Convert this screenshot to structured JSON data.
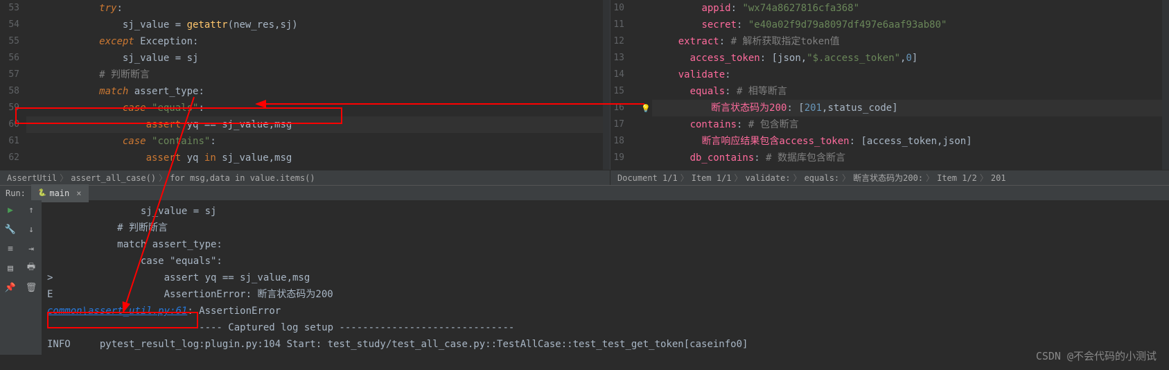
{
  "left_editor": {
    "lines": [
      {
        "n": 54,
        "indent": "                ",
        "tokens": [
          {
            "t": "sj_value ",
            "c": "var"
          },
          {
            "t": "= ",
            "c": "var"
          },
          {
            "t": "getattr",
            "c": "fn"
          },
          {
            "t": "(new_res,sj)",
            "c": "var"
          }
        ]
      },
      {
        "n": 55,
        "indent": "            ",
        "tokens": [
          {
            "t": "except ",
            "c": "kw"
          },
          {
            "t": "Exception",
            "c": "var"
          },
          {
            "t": ":",
            "c": "var"
          }
        ]
      },
      {
        "n": 56,
        "indent": "                ",
        "tokens": [
          {
            "t": "sj_value ",
            "c": "var"
          },
          {
            "t": "= ",
            "c": "var"
          },
          {
            "t": "sj",
            "c": "var"
          }
        ]
      },
      {
        "n": 57,
        "indent": "            ",
        "tokens": [
          {
            "t": "# 判断断言",
            "c": "cmt"
          }
        ]
      },
      {
        "n": 58,
        "indent": "            ",
        "tokens": [
          {
            "t": "match ",
            "c": "kw"
          },
          {
            "t": "assert_type",
            "c": "var"
          },
          {
            "t": ":",
            "c": "var"
          }
        ]
      },
      {
        "n": 59,
        "indent": "                ",
        "tokens": [
          {
            "t": "case ",
            "c": "kw"
          },
          {
            "t": "\"equals\"",
            "c": "str"
          },
          {
            "t": ":",
            "c": "var"
          }
        ]
      },
      {
        "n": 60,
        "indent": "                    ",
        "tokens": [
          {
            "t": "assert ",
            "c": "kw2"
          },
          {
            "t": "yq ",
            "c": "var"
          },
          {
            "t": "== ",
            "c": "var"
          },
          {
            "t": "sj_value,msg",
            "c": "var"
          }
        ],
        "hl": true
      },
      {
        "n": 61,
        "indent": "                ",
        "tokens": [
          {
            "t": "case ",
            "c": "kw"
          },
          {
            "t": "\"contains\"",
            "c": "str"
          },
          {
            "t": ":",
            "c": "var"
          }
        ]
      },
      {
        "n": 62,
        "indent": "                    ",
        "tokens": [
          {
            "t": "assert ",
            "c": "kw2"
          },
          {
            "t": "yq ",
            "c": "var"
          },
          {
            "t": "in ",
            "c": "kw2"
          },
          {
            "t": "sj_value,msg",
            "c": "var"
          }
        ]
      }
    ],
    "first_line_num": 54,
    "line_53_tokens": [
      {
        "t": "            ",
        "c": "var"
      },
      {
        "t": "try",
        "c": "kw"
      },
      {
        "t": ":",
        "c": "var"
      }
    ],
    "breadcrumb": [
      "AssertUtil",
      "assert_all_case()",
      "for msg,data in value.items()"
    ]
  },
  "right_editor": {
    "lines": [
      {
        "n": 10,
        "indent": "        ",
        "tokens": [
          {
            "t": "appid",
            "c": "yaml-key"
          },
          {
            "t": ": ",
            "c": "var"
          },
          {
            "t": "\"wx74a8627816cfa368\"",
            "c": "yaml-val"
          }
        ]
      },
      {
        "n": 11,
        "indent": "        ",
        "tokens": [
          {
            "t": "secret",
            "c": "yaml-key"
          },
          {
            "t": ": ",
            "c": "var"
          },
          {
            "t": "\"e40a02f9d79a8097df497e6aaf93ab80\"",
            "c": "yaml-val"
          }
        ]
      },
      {
        "n": 12,
        "indent": "    ",
        "tokens": [
          {
            "t": "extract",
            "c": "yaml-key"
          },
          {
            "t": ": ",
            "c": "var"
          },
          {
            "t": "# 解析获取指定token值",
            "c": "cmt"
          }
        ]
      },
      {
        "n": 13,
        "indent": "      ",
        "tokens": [
          {
            "t": "access_token",
            "c": "yaml-key"
          },
          {
            "t": ": ",
            "c": "var"
          },
          {
            "t": "[",
            "c": "brkt"
          },
          {
            "t": "json",
            "c": "var"
          },
          {
            "t": ",",
            "c": "var"
          },
          {
            "t": "\"$.access_token\"",
            "c": "yaml-val"
          },
          {
            "t": ",",
            "c": "var"
          },
          {
            "t": "0",
            "c": "num"
          },
          {
            "t": "]",
            "c": "brkt"
          }
        ]
      },
      {
        "n": 14,
        "indent": "    ",
        "tokens": [
          {
            "t": "validate",
            "c": "yaml-key"
          },
          {
            "t": ":",
            "c": "var"
          }
        ]
      },
      {
        "n": 15,
        "indent": "      ",
        "tokens": [
          {
            "t": "equals",
            "c": "yaml-key"
          },
          {
            "t": ": ",
            "c": "var"
          },
          {
            "t": "# 相等断言",
            "c": "cmt"
          }
        ]
      },
      {
        "n": 16,
        "indent": "        ",
        "tokens": [
          {
            "t": "断言状态码为200",
            "c": "yaml-key"
          },
          {
            "t": ": ",
            "c": "var"
          },
          {
            "t": "[",
            "c": "brkt"
          },
          {
            "t": "201",
            "c": "num"
          },
          {
            "t": ",",
            "c": "var"
          },
          {
            "t": "status_code",
            "c": "var"
          },
          {
            "t": "]",
            "c": "brkt"
          }
        ],
        "hl": true,
        "bulb": true
      },
      {
        "n": 17,
        "indent": "      ",
        "tokens": [
          {
            "t": "contains",
            "c": "yaml-key"
          },
          {
            "t": ": ",
            "c": "var"
          },
          {
            "t": "# 包含断言",
            "c": "cmt"
          }
        ]
      },
      {
        "n": 18,
        "indent": "        ",
        "tokens": [
          {
            "t": "断言响应结果包含access_token",
            "c": "yaml-key"
          },
          {
            "t": ": ",
            "c": "var"
          },
          {
            "t": "[",
            "c": "brkt"
          },
          {
            "t": "access_token",
            "c": "var"
          },
          {
            "t": ",",
            "c": "var"
          },
          {
            "t": "json",
            "c": "var"
          },
          {
            "t": "]",
            "c": "brkt"
          }
        ]
      },
      {
        "n": 19,
        "indent": "      ",
        "tokens": [
          {
            "t": "db_contains",
            "c": "yaml-key"
          },
          {
            "t": ": ",
            "c": "var"
          },
          {
            "t": "# 数据库包含断言",
            "c": "cmt"
          }
        ]
      }
    ],
    "breadcrumb": [
      "Document 1/1",
      "Item 1/1",
      "validate:",
      "equals:",
      "断言状态码为200:",
      "Item 1/2",
      "201"
    ]
  },
  "run": {
    "label": "Run:",
    "tab": "main"
  },
  "console": {
    "lines": [
      "                sj_value = sj",
      "            # 判断断言",
      "            match assert_type:",
      "                case \"equals\":",
      ">                   assert yq == sj_value,msg",
      "E                   AssertionError: 断言状态码为200",
      "",
      "",
      "------------------------------ Captured log setup ------------------------------",
      "INFO     pytest_result_log:plugin.py:104 Start: test_study/test_all_case.py::TestAllCase::test_test_get_token[caseinfo0]"
    ],
    "link_text": "common\\assert_util.py",
    "link_line": ":61",
    "link_suffix": ": AssertionError"
  },
  "watermark": "CSDN @不会代码的小测试"
}
